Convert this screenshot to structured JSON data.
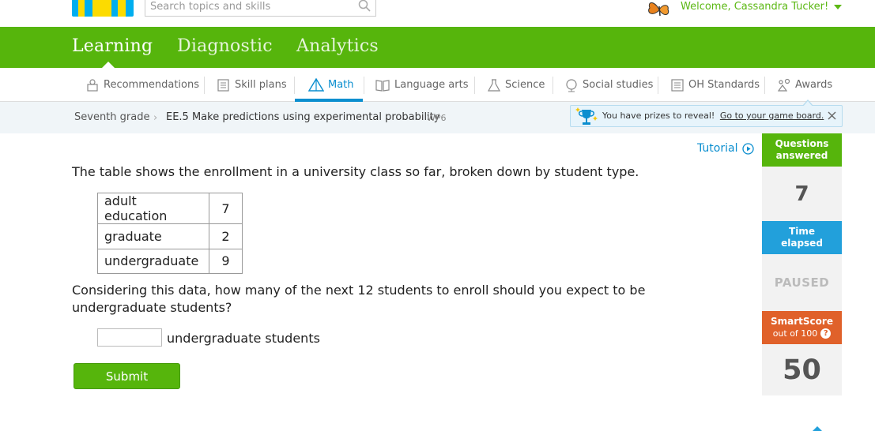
{
  "topbar": {
    "search_placeholder": "Search topics and skills",
    "welcome": "Welcome, Cassandra Tucker!"
  },
  "main_nav": {
    "tabs": [
      {
        "label": "Learning",
        "active": true
      },
      {
        "label": "Diagnostic",
        "active": false
      },
      {
        "label": "Analytics",
        "active": false
      }
    ]
  },
  "subject_nav": {
    "items": [
      {
        "label": "Recommendations",
        "icon": "recommendations-icon"
      },
      {
        "label": "Skill plans",
        "icon": "skill-plans-icon"
      },
      {
        "label": "Math",
        "icon": "math-icon",
        "active": true
      },
      {
        "label": "Language arts",
        "icon": "book-icon"
      },
      {
        "label": "Science",
        "icon": "flask-icon"
      },
      {
        "label": "Social studies",
        "icon": "globe-icon"
      },
      {
        "label": "OH Standards",
        "icon": "standards-icon"
      },
      {
        "label": "Awards",
        "icon": "awards-icon"
      }
    ]
  },
  "breadcrumb": {
    "grade": "Seventh grade",
    "skill": "EE.5 Make predictions using experimental probability",
    "code": "WP6"
  },
  "prize_banner": {
    "text": "You have prizes to reveal!",
    "link": "Go to your game board."
  },
  "tutorial": "Tutorial",
  "question": {
    "prompt": "The table shows the enrollment in a university class so far, broken down by student type.",
    "table": [
      {
        "type": "adult education",
        "count": "7"
      },
      {
        "type": "graduate",
        "count": "2"
      },
      {
        "type": "undergraduate",
        "count": "9"
      }
    ],
    "text": "Considering this data, how many of the next 12 students to enroll should you expect to be undergraduate students?",
    "answer_value": "",
    "unit": "undergraduate students",
    "submit_label": "Submit"
  },
  "side_panel": {
    "questions_answered_label": "Questions answered",
    "questions_answered": "7",
    "time_elapsed_label": "Time elapsed",
    "time_elapsed": "PAUSED",
    "smartscore_label": "SmartScore",
    "smartscore_sub": "out of 100",
    "smartscore_help": "?",
    "smartscore": "50"
  },
  "colors": {
    "brand_green": "#56b50c",
    "link_blue": "#0a8ecf",
    "time_blue": "#22a0db",
    "score_orange": "#e0612a"
  }
}
